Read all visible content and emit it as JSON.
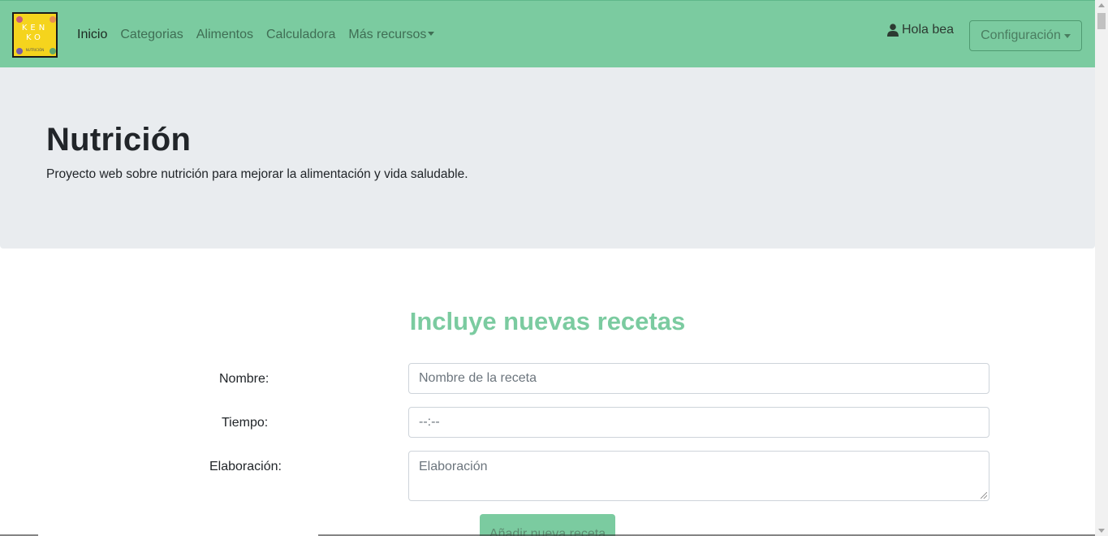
{
  "navbar": {
    "logo": {
      "line1": "KEN",
      "line2": "KO",
      "tagline": "NUTRICIÓN"
    },
    "links": [
      {
        "label": "Inicio"
      },
      {
        "label": "Categorias"
      },
      {
        "label": "Alimentos"
      },
      {
        "label": "Calculadora"
      },
      {
        "label": "Más recursos"
      }
    ],
    "user_greeting": "Hola bea",
    "config_label": "Configuración"
  },
  "jumbotron": {
    "title": "Nutrición",
    "subtitle": "Proyecto web sobre nutrición para mejorar la alimentación y vida saludable."
  },
  "form": {
    "title": "Incluye nuevas recetas",
    "fields": [
      {
        "label": "Nombre:",
        "placeholder": "Nombre de la receta"
      },
      {
        "label": "Tiempo:",
        "placeholder": "--:--"
      },
      {
        "label": "Elaboración:",
        "placeholder": "Elaboración"
      }
    ],
    "submit_label": "Añadir nueva receta"
  },
  "colors": {
    "brand_green": "#7bcba0",
    "logo_yellow": "#f5d41d",
    "jumbotron_bg": "#e9ecef"
  },
  "icons": {
    "user": "user-icon",
    "dropdown": "chevron-down-icon"
  }
}
